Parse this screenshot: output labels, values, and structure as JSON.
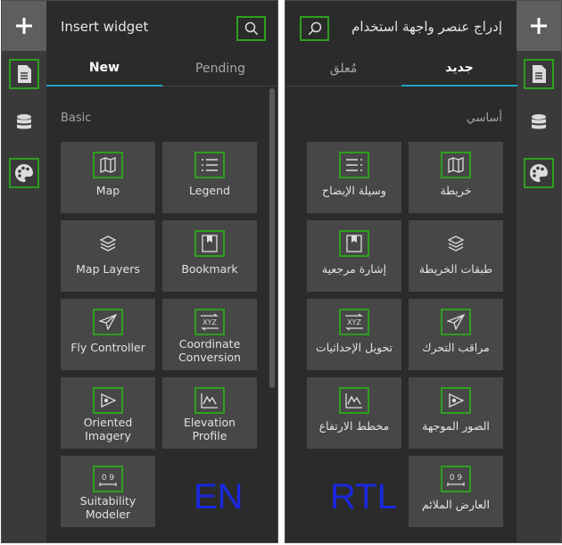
{
  "panels": {
    "en": {
      "title": "Insert widget",
      "tabs": [
        "New",
        "Pending"
      ],
      "section": "Basic",
      "widgets": [
        {
          "label": "Map",
          "icon": "map-icon"
        },
        {
          "label": "Legend",
          "icon": "legend-icon"
        },
        {
          "label": "Map Layers",
          "icon": "layers-icon"
        },
        {
          "label": "Bookmark",
          "icon": "bookmark-icon"
        },
        {
          "label": "Fly Controller",
          "icon": "fly-icon"
        },
        {
          "label": "Coordinate Conversion",
          "icon": "coordinate-icon"
        },
        {
          "label": "Oriented Imagery",
          "icon": "oriented-imagery-icon"
        },
        {
          "label": "Elevation Profile",
          "icon": "elevation-icon"
        },
        {
          "label": "Suitability Modeler",
          "icon": "suitability-icon"
        }
      ],
      "marker": "EN"
    },
    "rtl": {
      "title": "إدراج عنصر واجهة استخدام",
      "tabs": [
        "جديد",
        "مُعلق"
      ],
      "section": "أساسي",
      "widgets": [
        {
          "label": "خريطة",
          "icon": "map-icon"
        },
        {
          "label": "وسيلة الإيضاح",
          "icon": "legend-icon"
        },
        {
          "label": "طبقات الخريطة",
          "icon": "layers-icon"
        },
        {
          "label": "إشارة مرجعية",
          "icon": "bookmark-icon"
        },
        {
          "label": "مراقب التحرك",
          "icon": "fly-icon"
        },
        {
          "label": "تحويل الإحداثيات",
          "icon": "coordinate-icon"
        },
        {
          "label": "الصور الموجهة",
          "icon": "oriented-imagery-icon"
        },
        {
          "label": "مخطط الارتفاع",
          "icon": "elevation-icon"
        },
        {
          "label": "العارض الملائم",
          "icon": "suitability-icon"
        }
      ],
      "marker": "RTL"
    }
  },
  "rail_icons": [
    "add-icon",
    "page-icon",
    "data-icon",
    "theme-icon"
  ],
  "colors": {
    "highlight": "#2f9e20",
    "active_tab": "#23a3c9",
    "marker": "#1a28e0"
  }
}
